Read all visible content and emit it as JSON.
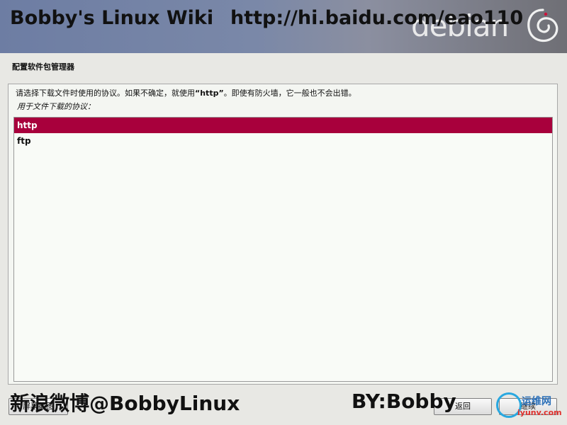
{
  "banner": {
    "title": "Bobby's Linux Wiki",
    "url": "http://hi.baidu.com/eao110",
    "logo_text": "debian"
  },
  "dialog": {
    "heading": "配置软件包管理器",
    "description_before": "请选择下载文件时使用的协议。如果不确定，就使用",
    "description_highlight": "“http”",
    "description_after": "。即使有防火墙，它一般也不会出错。",
    "list_label": "用于文件下载的协议：",
    "options": [
      {
        "label": "http",
        "selected": true
      },
      {
        "label": "ftp",
        "selected": false
      }
    ],
    "selected_color": "#a8003c"
  },
  "buttons": {
    "screenshot": "屏幕截图",
    "back": "返回",
    "continue": "继续"
  },
  "overlay": {
    "weibo": "新浪微博@BobbyLinux",
    "by": "BY:Bobby"
  },
  "watermark": {
    "cn": "运维网",
    "en": "iyunv.com"
  }
}
